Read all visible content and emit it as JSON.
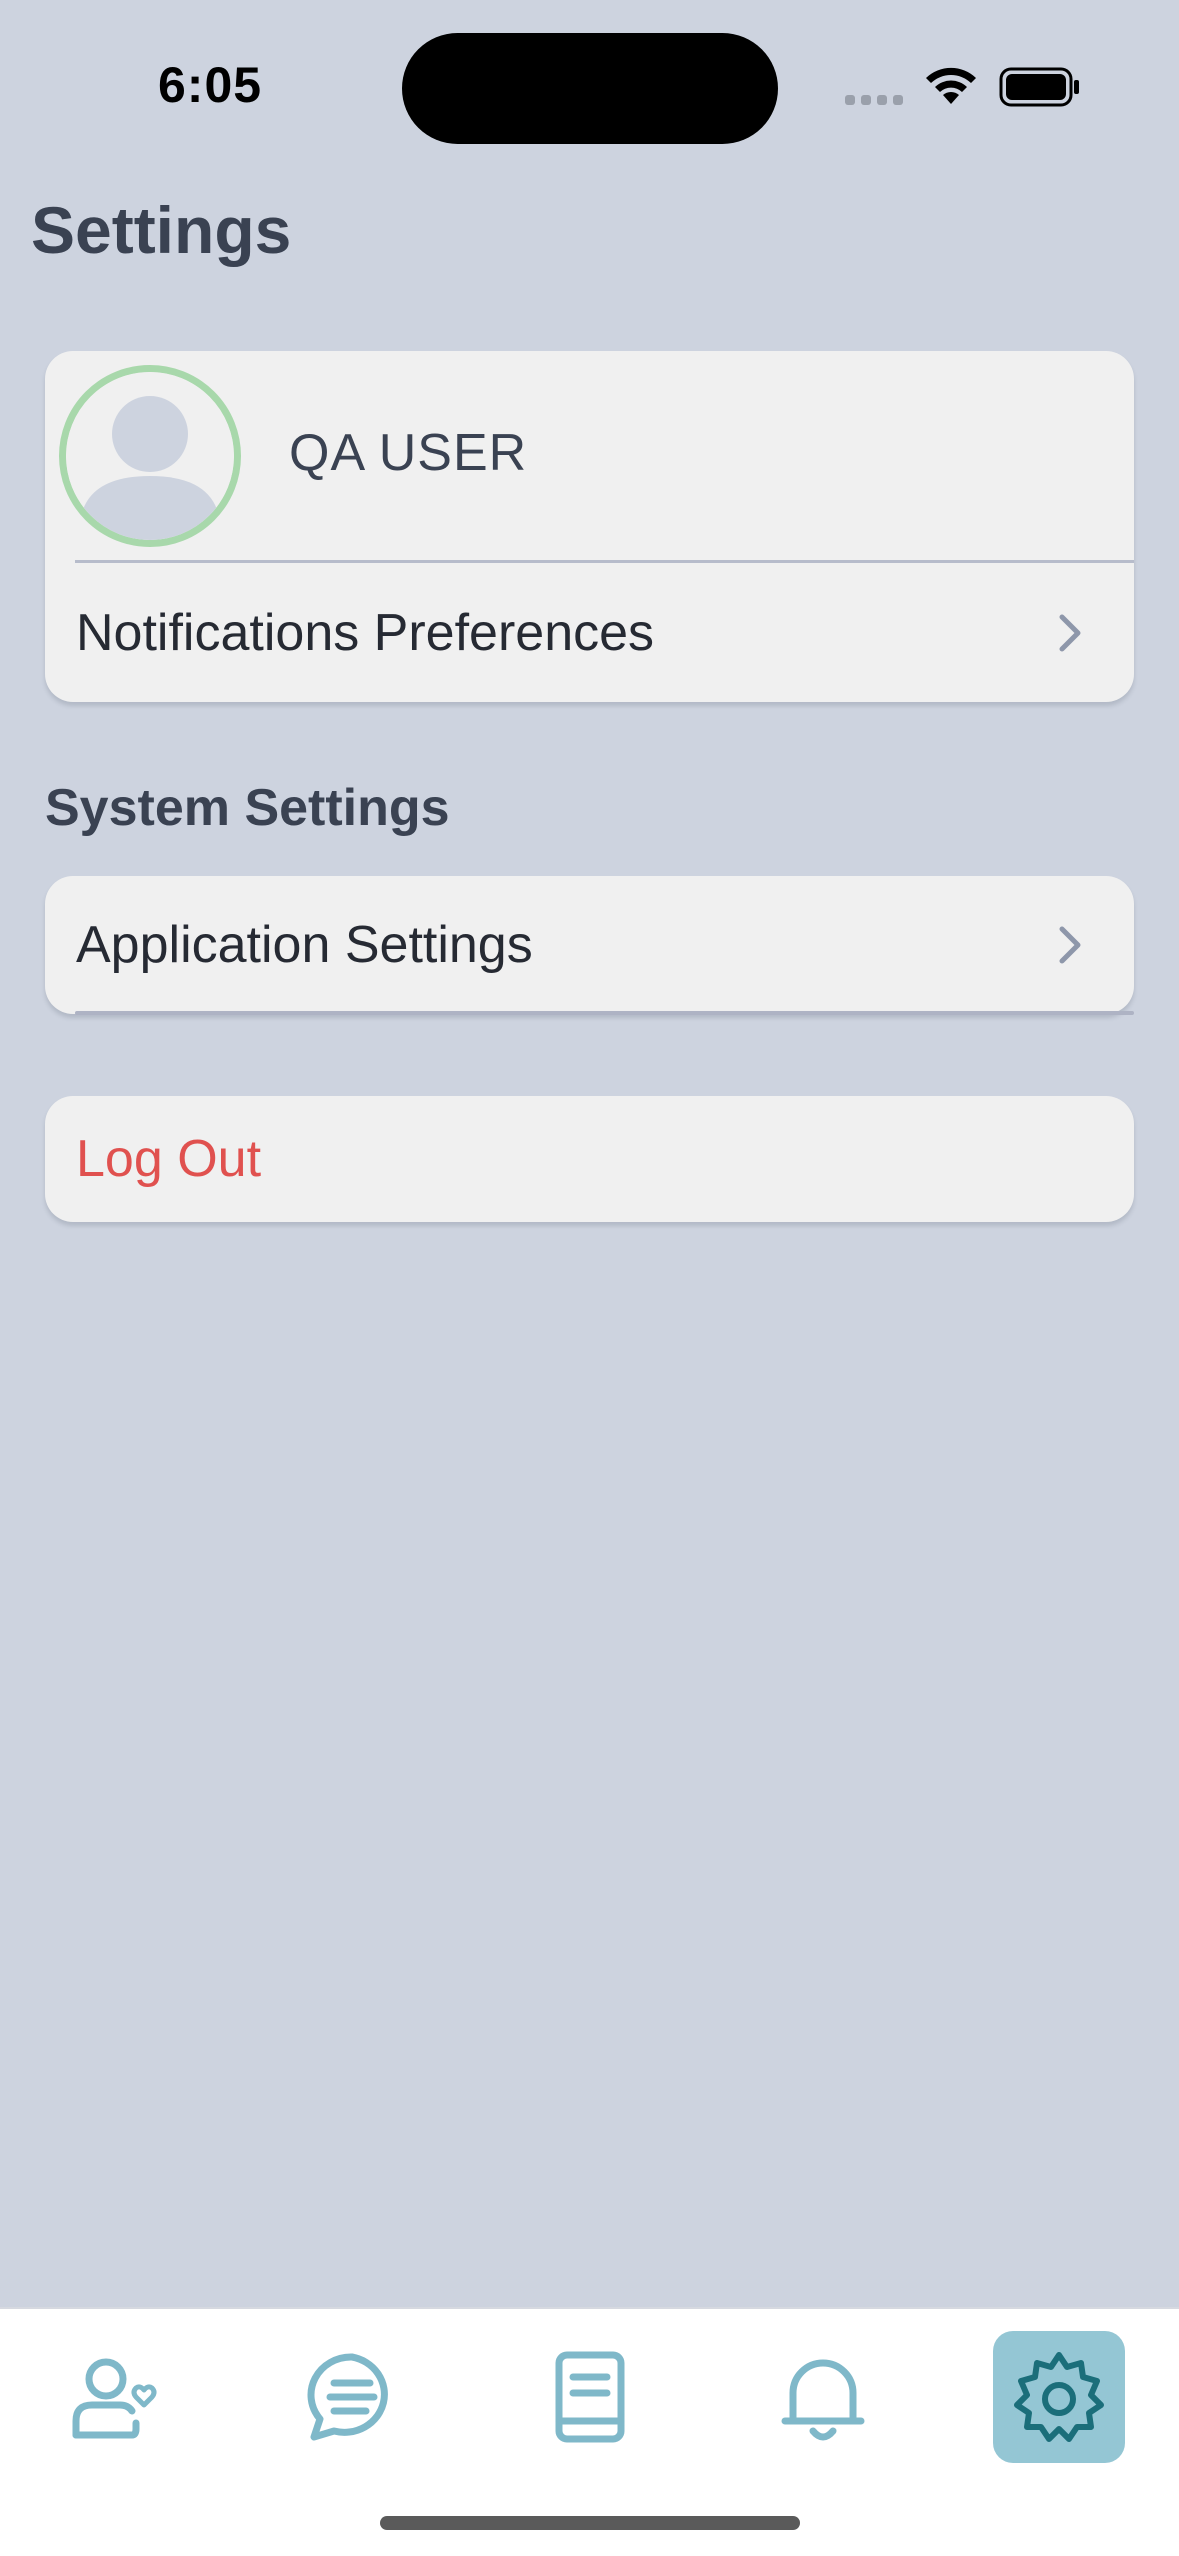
{
  "status_bar": {
    "time": "6:05",
    "icons": [
      "cellular-signal-icon",
      "wifi-icon",
      "battery-icon"
    ]
  },
  "page": {
    "title": "Settings"
  },
  "profile": {
    "user_name": "QA USER",
    "avatar_icon": "user-avatar-icon",
    "avatar_ring_color": "#a8d8ab"
  },
  "account_items": [
    {
      "label": "Notifications Preferences",
      "icon": "chevron-right-icon"
    }
  ],
  "system_section": {
    "title": "System Settings",
    "items": [
      {
        "label": "Application Settings",
        "icon": "chevron-right-icon"
      }
    ]
  },
  "logout": {
    "label": "Log Out",
    "color": "#e0514f"
  },
  "tab_bar": {
    "tabs": [
      {
        "icon": "user-heart-icon",
        "active": false
      },
      {
        "icon": "chat-bubble-icon",
        "active": false
      },
      {
        "icon": "book-icon",
        "active": false
      },
      {
        "icon": "bell-icon",
        "active": false
      },
      {
        "icon": "gear-icon",
        "active": true
      }
    ],
    "accent_color": "#7fb8c9",
    "active_bg": "#94c6d4",
    "active_icon_color": "#1b6e7a"
  },
  "colors": {
    "background": "#cdd3df",
    "card": "#f0f0f0",
    "heading": "#3a4252"
  }
}
